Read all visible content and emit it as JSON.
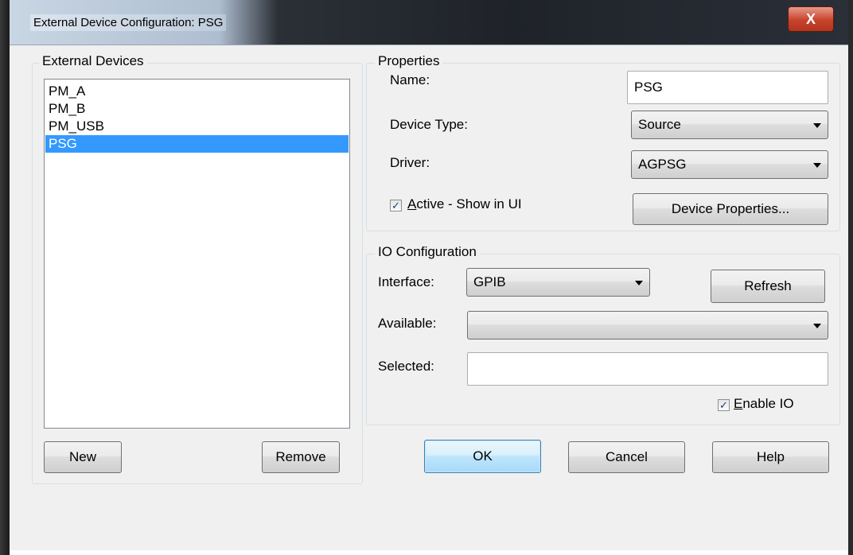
{
  "window": {
    "title": "External Device Configuration: PSG",
    "close_label": "X"
  },
  "devices_group": {
    "legend": "External Devices",
    "items": [
      {
        "label": "PM_A",
        "selected": false
      },
      {
        "label": "PM_B",
        "selected": false
      },
      {
        "label": "PM_USB",
        "selected": false
      },
      {
        "label": "PSG",
        "selected": true
      }
    ],
    "new_label": "New",
    "remove_label": "Remove"
  },
  "properties": {
    "legend": "Properties",
    "name_label": "Name:",
    "name_value": "PSG",
    "device_type_label": "Device Type:",
    "device_type_value": "Source",
    "driver_label": "Driver:",
    "driver_value": "AGPSG",
    "active_checked": true,
    "active_label_accel": "A",
    "active_label_rest": "ctive - Show in UI",
    "device_properties_label": "Device Properties..."
  },
  "io": {
    "legend": "IO Configuration",
    "interface_label": "Interface:",
    "interface_value": "GPIB",
    "refresh_label": "Refresh",
    "available_label": "Available:",
    "available_value": "",
    "selected_label": "Selected:",
    "selected_value": "",
    "enable_checked": true,
    "enable_label_accel": "E",
    "enable_label_rest": "nable IO"
  },
  "footer": {
    "ok_label": "OK",
    "cancel_label": "Cancel",
    "help_label": "Help"
  },
  "colors": {
    "selection": "#3399ff",
    "dialog_bg": "#f0f0f0",
    "close_button": "#c7432c"
  }
}
